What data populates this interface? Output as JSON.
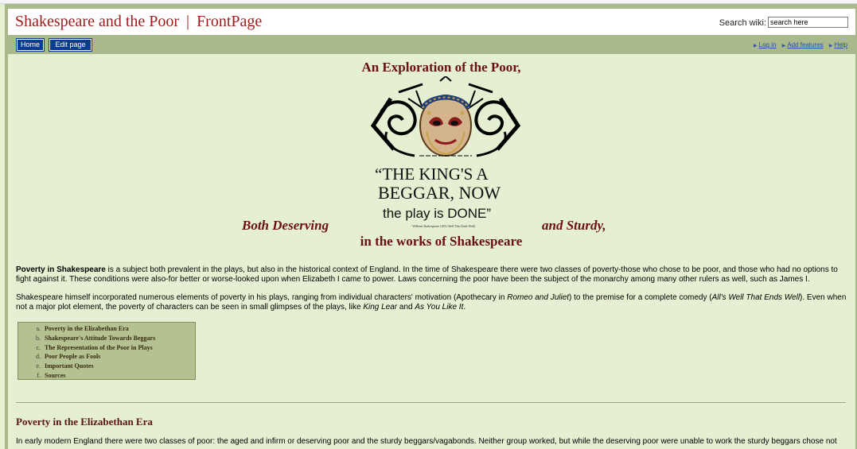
{
  "header": {
    "site_name": "Shakespeare and the Poor",
    "separator": "|",
    "page_name": "FrontPage",
    "search_label": "Search wiki:",
    "search_placeholder": "search here"
  },
  "nav": {
    "home_label": "Home",
    "edit_label": "Edit page",
    "links": [
      "Log in",
      "Add features",
      "Help"
    ]
  },
  "content": {
    "heading_top": "An Exploration of the Poor,",
    "heading_left": "Both Deserving",
    "heading_right": "and Sturdy,",
    "heading_bottom": "in the works of Shakespeare",
    "image": {
      "quote_line1": "“THE KING'S A",
      "quote_line2": "BEGGAR, NOW",
      "quote_line3": "the play is DONE”",
      "attribution": "- William Shakespeare (All's Well That Ends Well)"
    },
    "p1": {
      "lead": "Poverty in Shakespeare",
      "text": " is a subject both prevalent in the plays, but also in the historical context of England.  In the time of Shakespeare there were two classes of poverty-those who chose to be poor, and those who had no options to fight against it.  These conditions were also-for better or worse-looked upon when Elizabeth I came to power.  Laws concerning the poor have been the subject of the monarchy among many other rulers as well, such as James I."
    },
    "p2": {
      "t1": "Shakespeare himself incorporated numerous elements of poverty in his plays, ranging from individual characters' motivation (Apothecary in ",
      "i1": "Romeo and Juliet",
      "t2": ") to the premise for a complete comedy (",
      "i2": "All's Well That Ends Well",
      "t3": ").  Even when not a major plot element, the poverty of characters can be seen in small glimpses of the plays, like ",
      "i3": "King Lear",
      "t4": " and ",
      "i4": "As You Like It",
      "t5": "."
    },
    "toc": [
      {
        "letter": "a.",
        "label": "Poverty in the Elizabethan Era"
      },
      {
        "letter": "b.",
        "label": "Shakespeare's Attitude Towards Beggars"
      },
      {
        "letter": "c.",
        "label": "The Representation of the Poor in Plays"
      },
      {
        "letter": "d.",
        "label": "Poor People as Fools"
      },
      {
        "letter": "e.",
        "label": "Important Quotes"
      },
      {
        "letter": "f.",
        "label": "Sources"
      }
    ],
    "section_heading": "Poverty in the Elizabethan Era",
    "p3": "In early modern England there were two classes of poor: the aged and infirm or deserving poor and the sturdy beggars/vagabonds. Neither group worked, but while the deserving poor were unable to work the sturdy beggars chose not"
  },
  "colors": {
    "background": "#e5efd1",
    "frame": "#aab98c",
    "title_red": "#9e1b1b",
    "heading_maroon": "#6b1010",
    "button_blue": "#0a3d91",
    "link_blue": "#1f4fb8",
    "toc_bg": "#b3c290"
  }
}
